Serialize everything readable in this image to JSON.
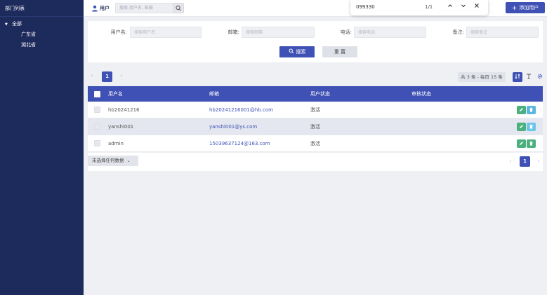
{
  "sidebar": {
    "title": "部门列表",
    "tree": {
      "root": "全部",
      "children": [
        "广东省",
        "湖北省"
      ]
    }
  },
  "topbar": {
    "section_label": "用户",
    "search_placeholder": "搜索 用户名, 邮箱",
    "add_button_label": "添加用户"
  },
  "find_bar": {
    "query": "099330",
    "match_count": "1/1"
  },
  "filters": {
    "username_label": "用户名:",
    "username_placeholder": "搜索用户名",
    "email_label": "邮箱:",
    "email_placeholder": "搜索邮箱",
    "phone_label": "电话:",
    "phone_placeholder": "搜索电话",
    "remark_label": "备注:",
    "remark_placeholder": "搜索备注",
    "search_button": "搜索",
    "reset_button": "重 置"
  },
  "pagination": {
    "prev": "‹",
    "next": "›",
    "current_page": "1",
    "total_info": "共 3 条 - 每页 15 条"
  },
  "table": {
    "columns": [
      "用户名",
      "邮箱",
      "用户状态",
      "审核状态"
    ],
    "rows": [
      {
        "username": "hb20241216",
        "email": "hb20241216001@hb.com",
        "status": "激活",
        "review": ""
      },
      {
        "username": "yanshi001",
        "email": "yanshi001@ys.com",
        "status": "激活",
        "review": ""
      },
      {
        "username": "admin",
        "email": "15039637124@163.com",
        "status": "激活",
        "review": ""
      }
    ]
  },
  "footer": {
    "selection_label": "未选择任何数据"
  },
  "colors": {
    "sidebar_bg": "#1d2a5c",
    "primary": "#3f51b5",
    "edit_action": "#4caf7e",
    "delete_action": "#5ab8e0"
  }
}
